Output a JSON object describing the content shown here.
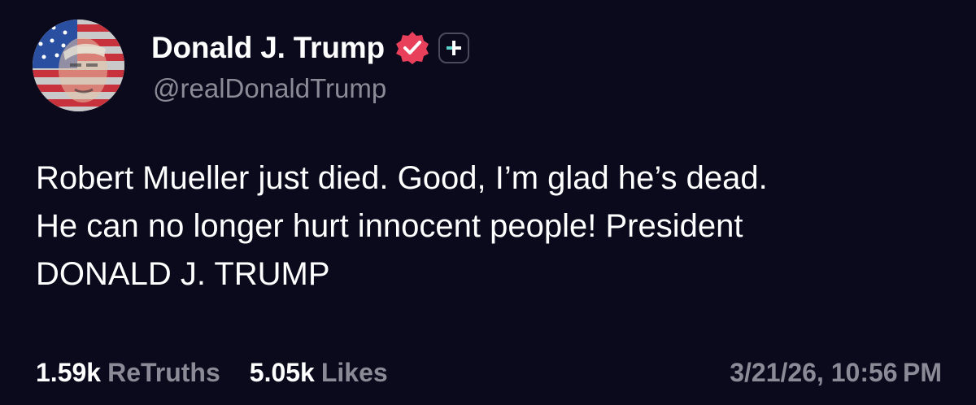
{
  "post": {
    "author": {
      "display_name": "Donald J. Trump",
      "handle": "@realDonaldTrump",
      "verified_icon": "verified-badge-icon",
      "badge_icon": "plus-badge-icon"
    },
    "text_lines": [
      "Robert Mueller just died. Good, I’m glad he’s dead.",
      "He can no longer hurt innocent people! President",
      "DONALD J. TRUMP"
    ],
    "stats": {
      "retruths_count": "1.59k",
      "retruths_label": "ReTruths",
      "likes_count": "5.05k",
      "likes_label": "Likes"
    },
    "timestamp": "3/21/26, 10:56 PM"
  },
  "colors": {
    "background": "#0b0a1c",
    "text_primary": "#ffffff",
    "text_secondary": "#8b8a96",
    "verified": "#e8405a",
    "plus_accent": "#5ad1c8"
  }
}
